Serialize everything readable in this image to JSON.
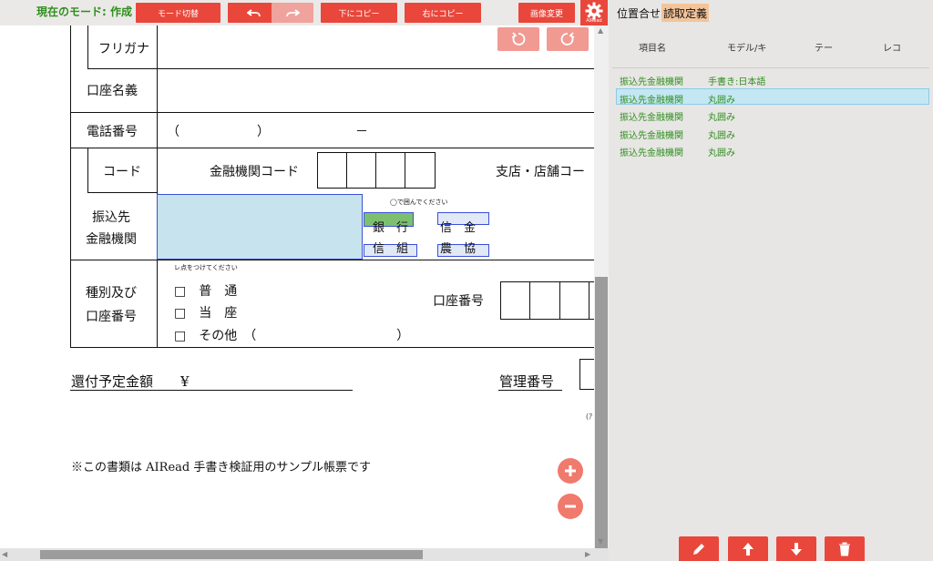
{
  "toolbar": {
    "mode_label": "現在のモード: 作成",
    "mode_switch": "モード切替",
    "undo": "undo-icon",
    "redo": "redo-icon",
    "copy_down": "下にコピー",
    "copy_right": "右にコピー",
    "image_change": "画像変更",
    "brand": "AIRead"
  },
  "form": {
    "furigana": "フリガナ",
    "account_name": "口座名義",
    "phone": "電話番号",
    "phone_open": "（",
    "phone_close": "）",
    "phone_dash": "－",
    "code": "コード",
    "bank_code": "金融機関コード",
    "branch_code": "支店・店舗コー",
    "dest_line1": "振込先",
    "dest_line2": "金融機関",
    "circle_hint": "◯で囲んでください",
    "bank": "銀　行",
    "shinkin": "信　金",
    "shinkumi": "信　組",
    "nokyo": "農　協",
    "type_line1": "種別及び",
    "type_line2": "口座番号",
    "check_hint": "レ点をつけてください",
    "futsu": "□　普　通",
    "toza": "□　当　座",
    "other": "□　その他　（　　　　　　　　　　　）",
    "account_no": "口座番号",
    "refund": "還付予定金額　　¥",
    "mgmt_no": "管理番号",
    "paren": "(ｱ",
    "footnote": "※この書類は AIRead 手書き検証用のサンプル帳票です"
  },
  "panel": {
    "tabs": [
      "位置合せ",
      "読取定義"
    ],
    "headers": [
      "項目名",
      "モデル/キ",
      "テー",
      "レコ"
    ],
    "rows": [
      {
        "name": "振込先金融機関",
        "model": "手書き:日本語"
      },
      {
        "name": "振込先金融機関",
        "model": "丸囲み"
      },
      {
        "name": "振込先金融機関",
        "model": "丸囲み"
      },
      {
        "name": "振込先金融機関",
        "model": "丸囲み"
      },
      {
        "name": "振込先金融機関",
        "model": "丸囲み"
      }
    ],
    "selected_row": 1,
    "buttons": [
      "pencil-icon",
      "arrow-up-icon",
      "arrow-down-icon",
      "trash-icon"
    ]
  },
  "colors": {
    "accent": "#e9473b",
    "mode_green": "#2f8f1f",
    "selection_fill": "#c7e3ee",
    "selection_border": "#3a4fd8",
    "chosen_green": "#7cc06f"
  }
}
